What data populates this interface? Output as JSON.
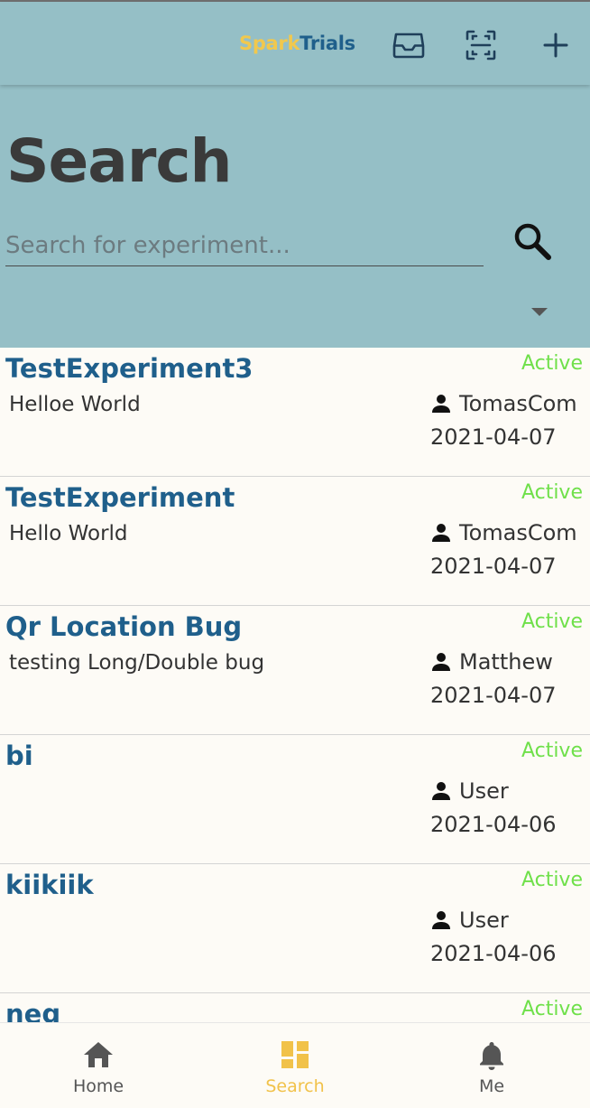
{
  "app": {
    "brand_part1": "Spark",
    "brand_part2": "Trials",
    "icons": [
      "inbox-icon",
      "qr-scan-icon",
      "add-icon"
    ]
  },
  "search": {
    "title": "Search",
    "placeholder": "Search for experiment...",
    "value": "",
    "button_icon": "search-icon",
    "dropdown_icon": "caret-down-icon"
  },
  "experiments": [
    {
      "title": "TestExperiment3",
      "description": "Helloe World",
      "status": "Active",
      "owner": "TomasCom",
      "date": "2021-04-07"
    },
    {
      "title": "TestExperiment",
      "description": "Hello World",
      "status": "Active",
      "owner": "TomasCom",
      "date": "2021-04-07"
    },
    {
      "title": "Qr Location Bug",
      "description": "testing Long/Double bug",
      "status": "Active",
      "owner": "Matthew",
      "date": "2021-04-07"
    },
    {
      "title": "bi",
      "description": "",
      "status": "Active",
      "owner": "User",
      "date": "2021-04-06"
    },
    {
      "title": "kiikiik",
      "description": "",
      "status": "Active",
      "owner": "User",
      "date": "2021-04-06"
    },
    {
      "title": "neg",
      "description": "",
      "status": "Active",
      "owner": "",
      "date": ""
    }
  ],
  "nav": [
    {
      "label": "Home",
      "icon": "home-icon",
      "active": false
    },
    {
      "label": "Search",
      "icon": "dashboard-icon",
      "active": true
    },
    {
      "label": "Me",
      "icon": "bell-icon",
      "active": false
    }
  ],
  "colors": {
    "header_bg": "#95bfc6",
    "brand_spark": "#f1c84d",
    "brand_trials": "#1f5f8b",
    "title_blue": "#1f5f8b",
    "status_active": "#6fe04a",
    "nav_active": "#f1c24a",
    "page_bg": "#fdfbf6"
  }
}
